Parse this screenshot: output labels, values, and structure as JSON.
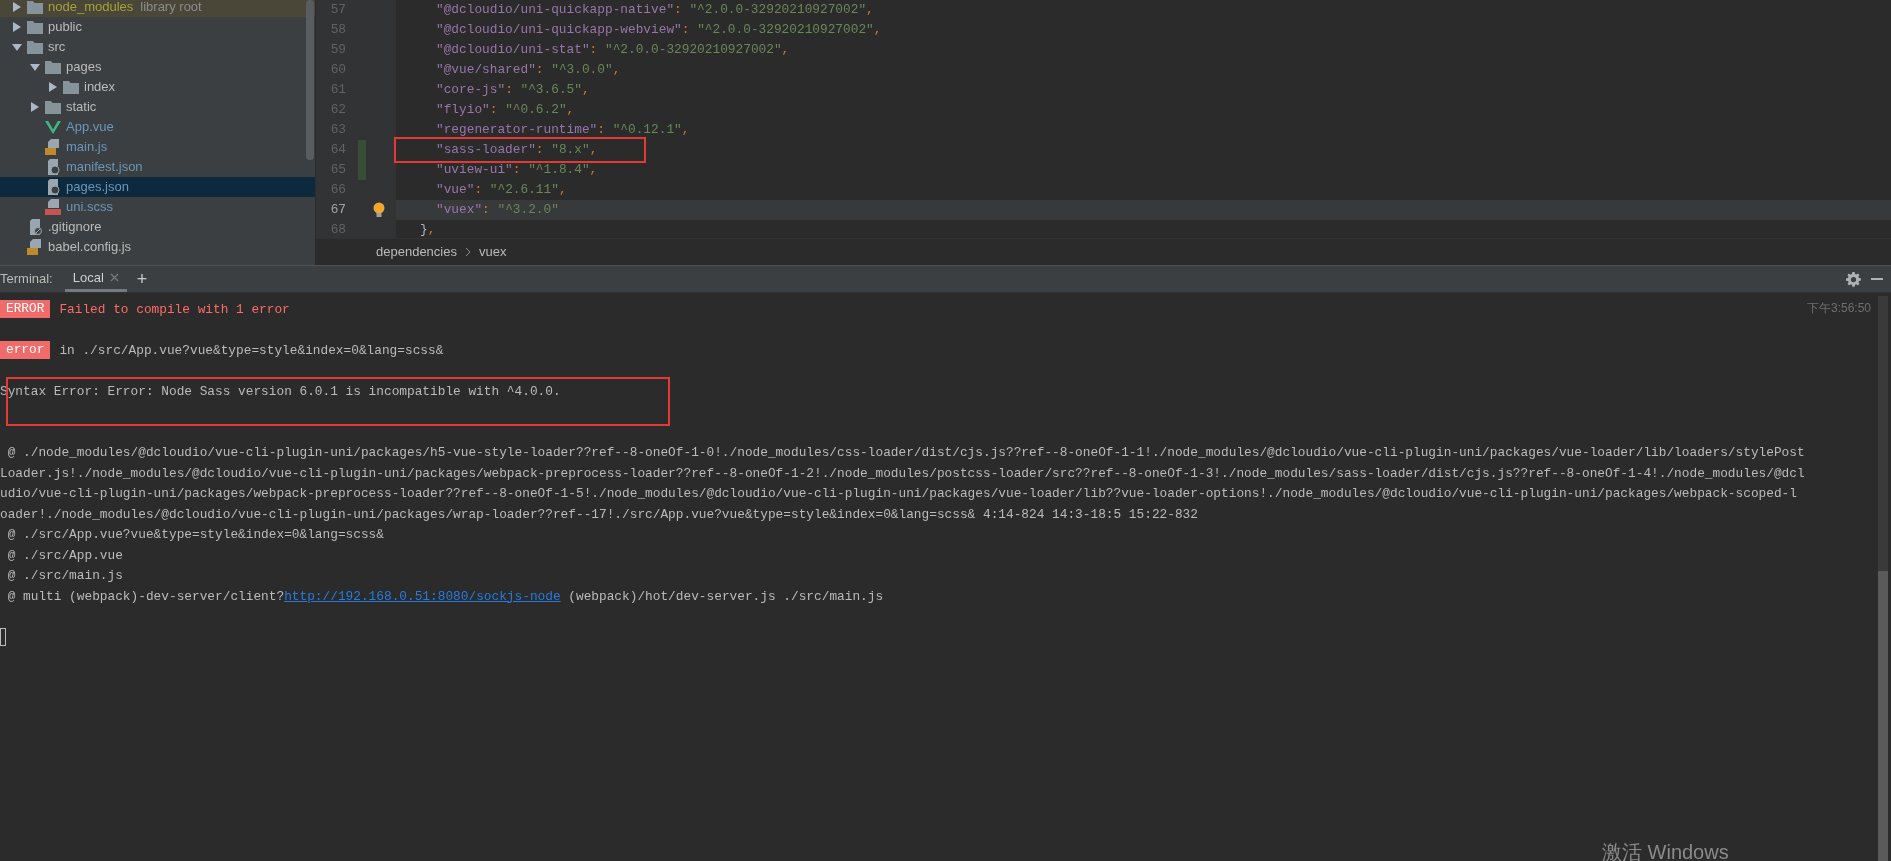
{
  "project_tree": [
    {
      "name": "node_modules",
      "note": "library root",
      "kind": "folder",
      "expanded": false,
      "selected": false,
      "excluded": true
    },
    {
      "name": "public",
      "kind": "folder",
      "expanded": false,
      "selected": false
    },
    {
      "name": "src",
      "kind": "folder",
      "expanded": true,
      "selected": false,
      "children": [
        {
          "name": "pages",
          "kind": "folder",
          "expanded": true,
          "selected": false,
          "children": [
            {
              "name": "index",
              "kind": "folder",
              "expanded": false,
              "selected": false
            }
          ]
        },
        {
          "name": "static",
          "kind": "folder",
          "expanded": false,
          "selected": false
        },
        {
          "name": "App.vue",
          "kind": "vue",
          "selected": false
        },
        {
          "name": "main.js",
          "kind": "js",
          "selected": false
        },
        {
          "name": "manifest.json",
          "kind": "json",
          "selected": false
        },
        {
          "name": "pages.json",
          "kind": "json",
          "selected": true
        },
        {
          "name": "uni.scss",
          "kind": "sass",
          "selected": false
        }
      ]
    },
    {
      "name": ".gitignore",
      "kind": "gitignore",
      "selected": false
    },
    {
      "name": "babel.config.js",
      "kind": "js",
      "selected": false
    }
  ],
  "editor": {
    "lines": [
      {
        "number": "57",
        "code": "\"@dcloudio/uni-quickapp-native\": \"^2.0.0-32920210927002\",",
        "current": false,
        "modified": false
      },
      {
        "number": "58",
        "code": "\"@dcloudio/uni-quickapp-webview\": \"^2.0.0-32920210927002\",",
        "current": false,
        "modified": false
      },
      {
        "number": "59",
        "code": "\"@dcloudio/uni-stat\": \"^2.0.0-32920210927002\",",
        "current": false,
        "modified": false
      },
      {
        "number": "60",
        "code": "\"@vue/shared\": \"^3.0.0\",",
        "current": false,
        "modified": false
      },
      {
        "number": "61",
        "code": "\"core-js\": \"^3.6.5\",",
        "current": false,
        "modified": false
      },
      {
        "number": "62",
        "code": "\"flyio\": \"^0.6.2\",",
        "current": false,
        "modified": false
      },
      {
        "number": "63",
        "code": "\"regenerator-runtime\": \"^0.12.1\",",
        "current": false,
        "modified": false
      },
      {
        "number": "64",
        "code": "\"sass-loader\": \"8.x\",",
        "current": false,
        "modified": true
      },
      {
        "number": "65",
        "code": "\"uview-ui\": \"^1.8.4\",",
        "current": false,
        "modified": true
      },
      {
        "number": "66",
        "code": "\"vue\": \"^2.6.11\",",
        "current": false,
        "modified": false
      },
      {
        "number": "67",
        "code": "\"vuex\": \"^3.2.0\"",
        "current": true,
        "modified": false
      },
      {
        "number": "68",
        "code": "},",
        "current": false,
        "modified": false
      }
    ],
    "breadcrumb": [
      "dependencies",
      "vuex"
    ]
  },
  "terminal": {
    "label": "Terminal:",
    "tabs": [
      {
        "label": "Local",
        "selected": true
      }
    ],
    "new_tab": "+",
    "timestamp": "下午3:56:50",
    "output": [
      {
        "kind": "error_header",
        "badge": "ERROR",
        "text": "Failed to compile with 1 error"
      },
      {
        "kind": "blank"
      },
      {
        "kind": "error_location",
        "badge": "error",
        "text": "in ./src/App.vue?vue&type=style&index=0&lang=scss&"
      },
      {
        "kind": "blank"
      },
      {
        "kind": "text",
        "text": "Syntax Error: Error: Node Sass version 6.0.1 is incompatible with ^4.0.0."
      },
      {
        "kind": "blank"
      },
      {
        "kind": "blank"
      },
      {
        "kind": "text",
        "text": " @ ./node_modules/@dcloudio/vue-cli-plugin-uni/packages/h5-vue-style-loader??ref--8-oneOf-1-0!./node_modules/css-loader/dist/cjs.js??ref--8-oneOf-1-1!./node_modules/@dcloudio/vue-cli-plugin-uni/packages/vue-loader/lib/loaders/stylePost"
      },
      {
        "kind": "text",
        "text": "Loader.js!./node_modules/@dcloudio/vue-cli-plugin-uni/packages/webpack-preprocess-loader??ref--8-oneOf-1-2!./node_modules/postcss-loader/src??ref--8-oneOf-1-3!./node_modules/sass-loader/dist/cjs.js??ref--8-oneOf-1-4!./node_modules/@dcl"
      },
      {
        "kind": "text",
        "text": "udio/vue-cli-plugin-uni/packages/webpack-preprocess-loader??ref--8-oneOf-1-5!./node_modules/@dcloudio/vue-cli-plugin-uni/packages/vue-loader/lib??vue-loader-options!./node_modules/@dcloudio/vue-cli-plugin-uni/packages/webpack-scoped-l"
      },
      {
        "kind": "text",
        "text": "oader!./node_modules/@dcloudio/vue-cli-plugin-uni/packages/wrap-loader??ref--17!./src/App.vue?vue&type=style&index=0&lang=scss& 4:14-824 14:3-18:5 15:22-832"
      },
      {
        "kind": "text",
        "text": " @ ./src/App.vue?vue&type=style&index=0&lang=scss&"
      },
      {
        "kind": "text",
        "text": " @ ./src/App.vue"
      },
      {
        "kind": "text",
        "text": " @ ./src/main.js"
      },
      {
        "kind": "link_line",
        "before": " @ multi (webpack)-dev-server/client?",
        "link": "http://192.168.0.51:8080/sockjs-node",
        "after": " (webpack)/hot/dev-server.js ./src/main.js"
      },
      {
        "kind": "blank"
      },
      {
        "kind": "cursor"
      }
    ]
  },
  "os_notice": "激活 Windows"
}
